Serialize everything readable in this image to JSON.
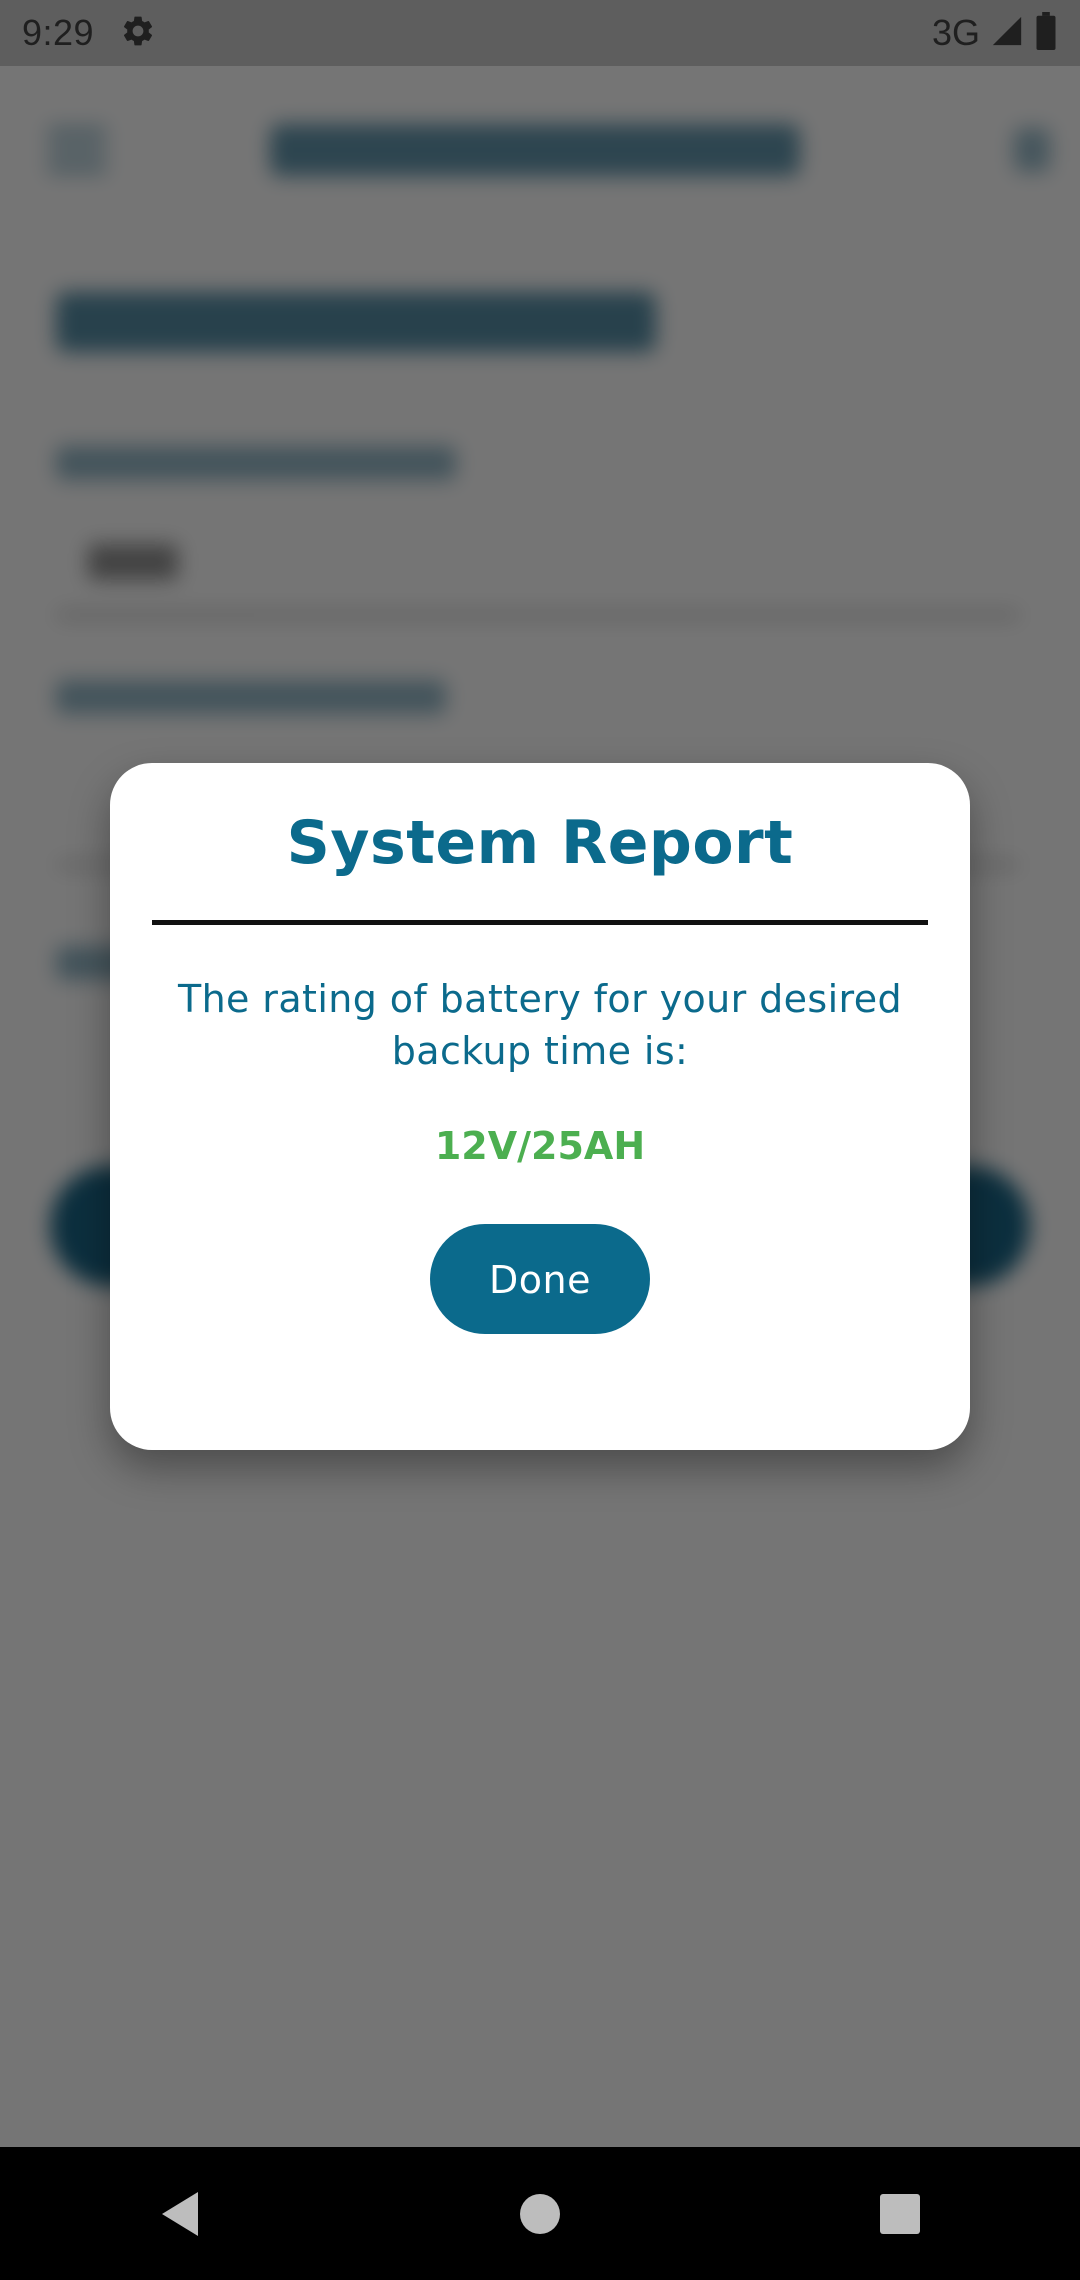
{
  "status_bar": {
    "time": "9:29",
    "settings_icon": "gear-icon",
    "network": "3G",
    "signal_icon": "signal-icon",
    "battery_icon": "battery-icon"
  },
  "dialog": {
    "title": "System Report",
    "message": "The rating of battery for your desired backup time is:",
    "value": "12V/25AH",
    "done_label": "Done"
  },
  "colors": {
    "accent": "#0b6a8c",
    "value": "#4caf50",
    "scrim": "#767676"
  },
  "nav_bar": {
    "back_icon": "back-triangle-icon",
    "home_icon": "home-circle-icon",
    "recents_icon": "recents-square-icon"
  }
}
